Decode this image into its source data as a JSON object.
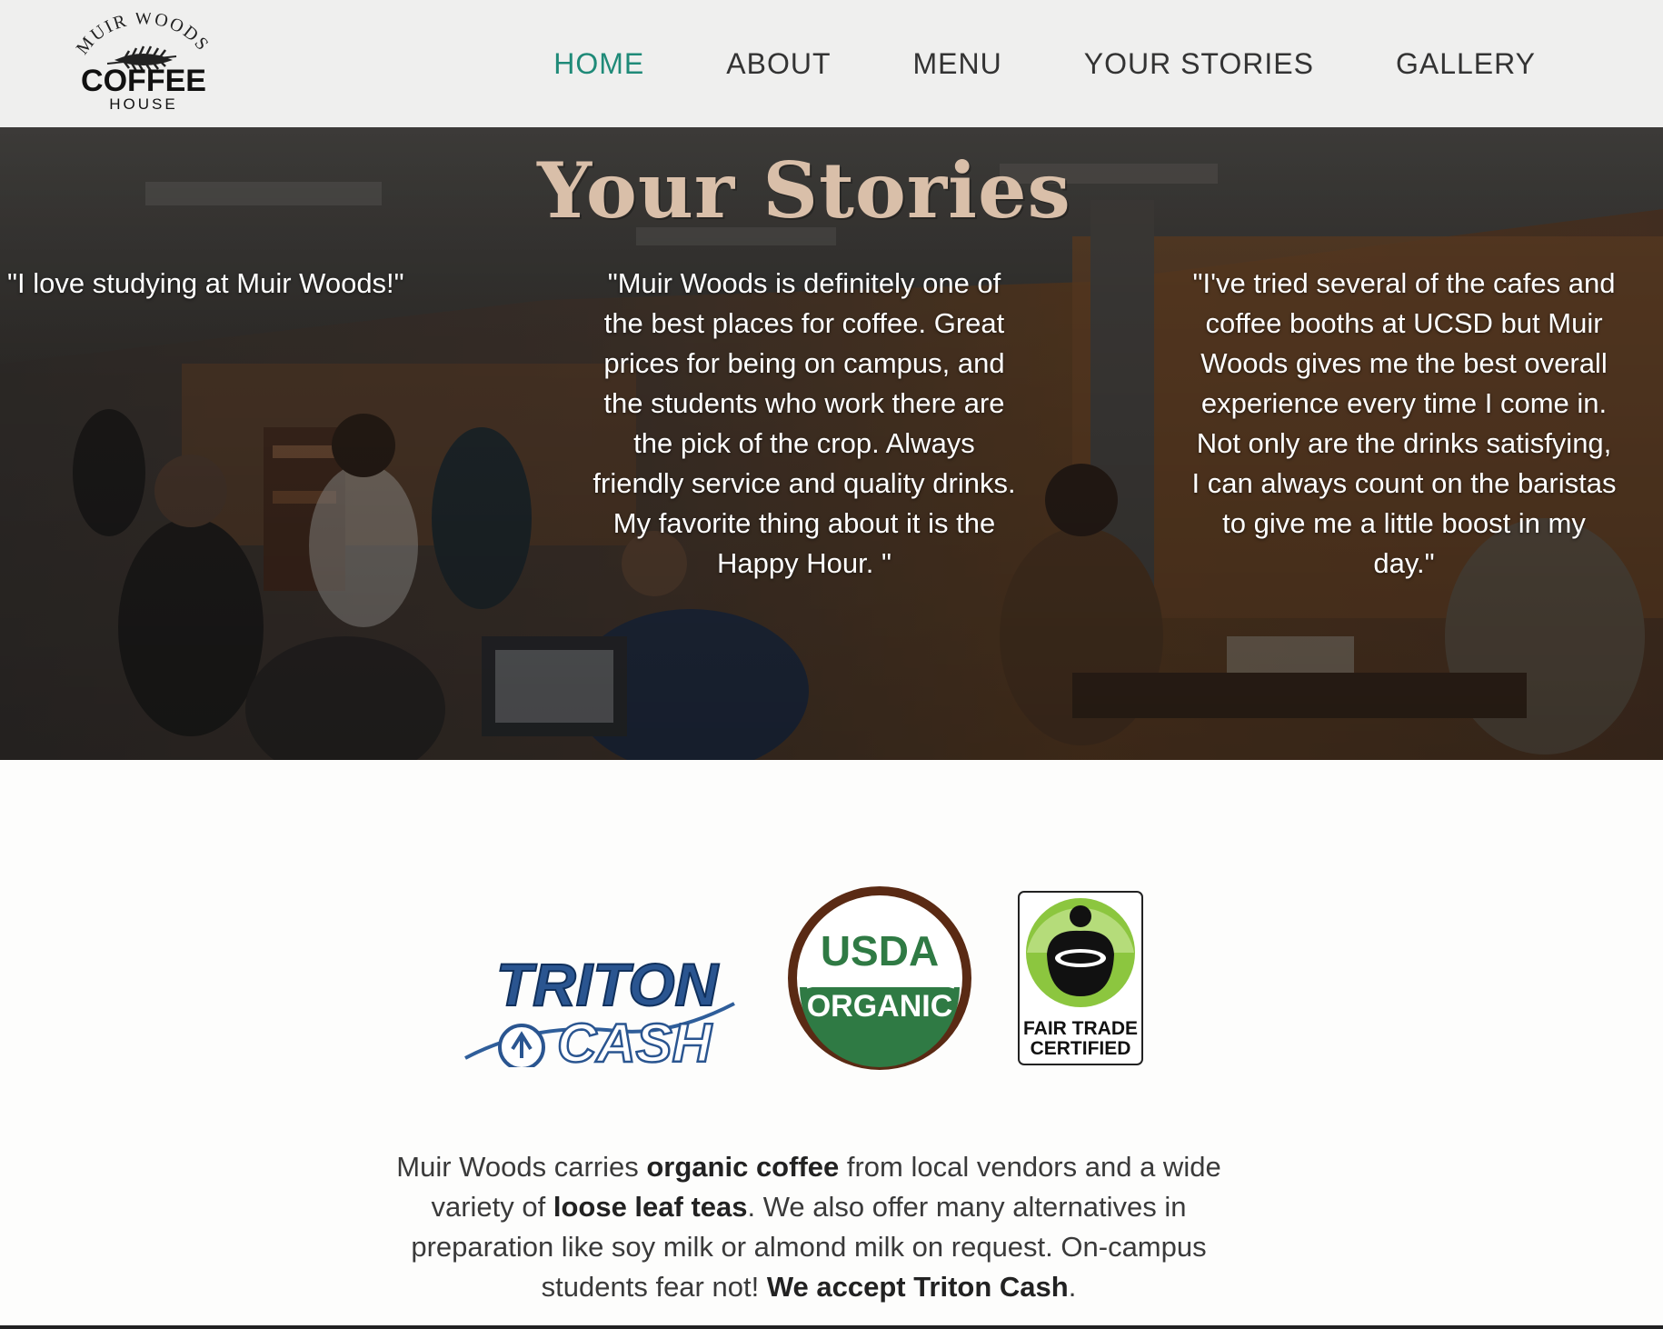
{
  "logo": {
    "arc_text": "MUIR WOODS",
    "main_text": "COFFEE",
    "sub_text": "HOUSE"
  },
  "nav": {
    "items": [
      {
        "label": "HOME",
        "active": true
      },
      {
        "label": "ABOUT",
        "active": false
      },
      {
        "label": "MENU",
        "active": false
      },
      {
        "label": "YOUR STORIES",
        "active": false
      },
      {
        "label": "GALLERY",
        "active": false
      }
    ],
    "active_color": "#1f8a78"
  },
  "hero": {
    "title": "Your Stories",
    "quotes": [
      "\"I love studying at Muir Woods!\"",
      "\"Muir Woods is definitely one of the best places for coffee. Great prices for being on campus, and the students who work there are the pick of the crop. Always friendly service and quality drinks. My favorite thing about it is the Happy Hour. \"",
      "\"I've tried several of the cafes and coffee booths at UCSD but Muir Woods gives me the best overall experience every time I come in. Not only are the drinks satisfying, I can always count on the baristas to give me a little boost in my day.\""
    ]
  },
  "badges": {
    "triton": {
      "line1": "TRITON",
      "line2": "CASH"
    },
    "usda": {
      "line1": "USDA",
      "line2": "ORGANIC"
    },
    "fairtrade": {
      "line1": "FAIR TRADE",
      "line2": "CERTIFIED"
    }
  },
  "description": {
    "part1": "Muir Woods carries ",
    "bold1": "organic coffee",
    "part2": " from local vendors and a wide variety of ",
    "bold2": "loose leaf teas",
    "part3": ". We also offer many alternatives in preparation like soy milk or almond milk on request. On-campus students fear not! ",
    "bold3": "We accept Triton Cash",
    "part4": "."
  }
}
